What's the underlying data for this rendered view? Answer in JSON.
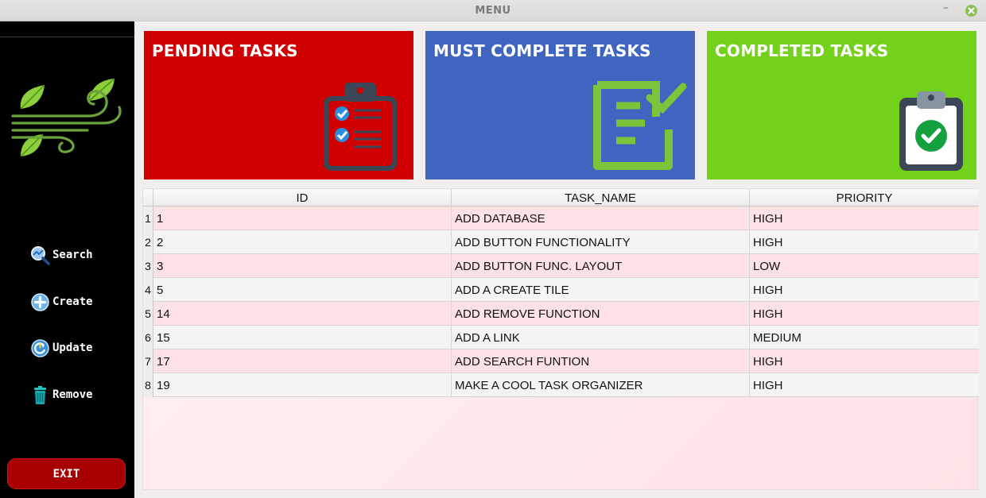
{
  "window": {
    "title": "MENU",
    "minimize_glyph": "–"
  },
  "sidebar": {
    "logo_icon": "leaf-wind-logo",
    "items": [
      {
        "label": "Search",
        "icon": "search-icon"
      },
      {
        "label": "Create",
        "icon": "plus-circle-icon"
      },
      {
        "label": "Update",
        "icon": "update-icon"
      },
      {
        "label": "Remove",
        "icon": "trash-icon"
      }
    ],
    "exit_label": "EXIT"
  },
  "tiles": [
    {
      "title": "PENDING TASKS",
      "color": "#d10000",
      "icon": "checklist-clipboard-icon"
    },
    {
      "title": "MUST COMPLETE TASKS",
      "color": "#3f65c0",
      "icon": "document-check-icon"
    },
    {
      "title": "COMPLETED TASKS",
      "color": "#74d11b",
      "icon": "clipboard-check-icon"
    }
  ],
  "table": {
    "columns": [
      "ID",
      "TASK_NAME",
      "PRIORITY"
    ],
    "rows": [
      {
        "num": "1",
        "id": "1",
        "task": "ADD DATABASE",
        "priority": "HIGH"
      },
      {
        "num": "2",
        "id": "2",
        "task": "ADD BUTTON FUNCTIONALITY",
        "priority": "HIGH"
      },
      {
        "num": "3",
        "id": "3",
        "task": "ADD BUTTON FUNC. LAYOUT",
        "priority": "LOW"
      },
      {
        "num": "4",
        "id": "5",
        "task": "ADD A CREATE TILE",
        "priority": "HIGH"
      },
      {
        "num": "5",
        "id": "14",
        "task": "ADD REMOVE FUNCTION",
        "priority": "HIGH"
      },
      {
        "num": "6",
        "id": "15",
        "task": "ADD A LINK",
        "priority": "MEDIUM"
      },
      {
        "num": "7",
        "id": "17",
        "task": "ADD SEARCH FUNTION",
        "priority": "HIGH"
      },
      {
        "num": "8",
        "id": "19",
        "task": "MAKE A COOL TASK ORGANIZER",
        "priority": "HIGH"
      }
    ]
  }
}
